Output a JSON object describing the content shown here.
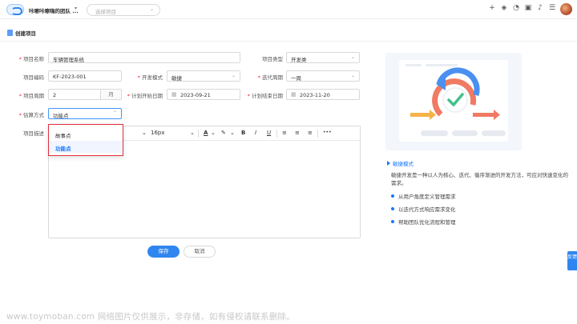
{
  "topbar": {
    "team_name": "咔嚓咔嚓嗨的团队 ...",
    "team_caret": "▾",
    "project_select_placeholder": "选择项目",
    "icons": [
      "plus-icon",
      "layers-icon",
      "pie-chart-icon",
      "briefcase-icon",
      "bell-icon",
      "sliders-icon"
    ]
  },
  "page": {
    "title": "创建项目"
  },
  "form": {
    "project_name": {
      "label": "项目名称",
      "value": "车辆管理系统"
    },
    "project_type": {
      "label": "项目类型",
      "value": "开发类"
    },
    "project_code": {
      "label": "项目编码",
      "value": "KF-2023-001"
    },
    "dev_mode": {
      "label": "开发模式",
      "value": "敏捷"
    },
    "iteration_cycle": {
      "label": "迭代周期",
      "value": "一周"
    },
    "project_cycle": {
      "label": "项目周期",
      "value": "2",
      "unit": "月"
    },
    "plan_start": {
      "label": "计划开始日期",
      "value": "2023-09-21"
    },
    "plan_end": {
      "label": "计划结束日期",
      "value": "2023-11-20"
    },
    "estimation": {
      "label": "估算方式",
      "value": "功能点",
      "options": [
        "故事点",
        "功能点"
      ],
      "selected_index": 1
    },
    "description": {
      "label": "项目描述",
      "font_size": "16px",
      "toolbar": [
        "A",
        "B",
        "I",
        "U",
        "•••"
      ]
    }
  },
  "buttons": {
    "save": "保存",
    "cancel": "取消"
  },
  "sidebar": {
    "title": "敏捷模式",
    "desc": "敏捷开发是一种以人为核心、迭代、循序渐进的开发方法，可应对快速变化的需求。",
    "bullets": [
      "从用户角度定义管理需求",
      "以迭代方式响应需求变化",
      "帮助团队优化流程和管理"
    ]
  },
  "feedback": "反馈",
  "watermark": "www.toymoban.com 网络图片仅供展示，非存储，如有侵权请联系删除。",
  "colors": {
    "primary": "#2f86f0",
    "required": "#f5222d",
    "highlight_border": "#e0303a"
  }
}
